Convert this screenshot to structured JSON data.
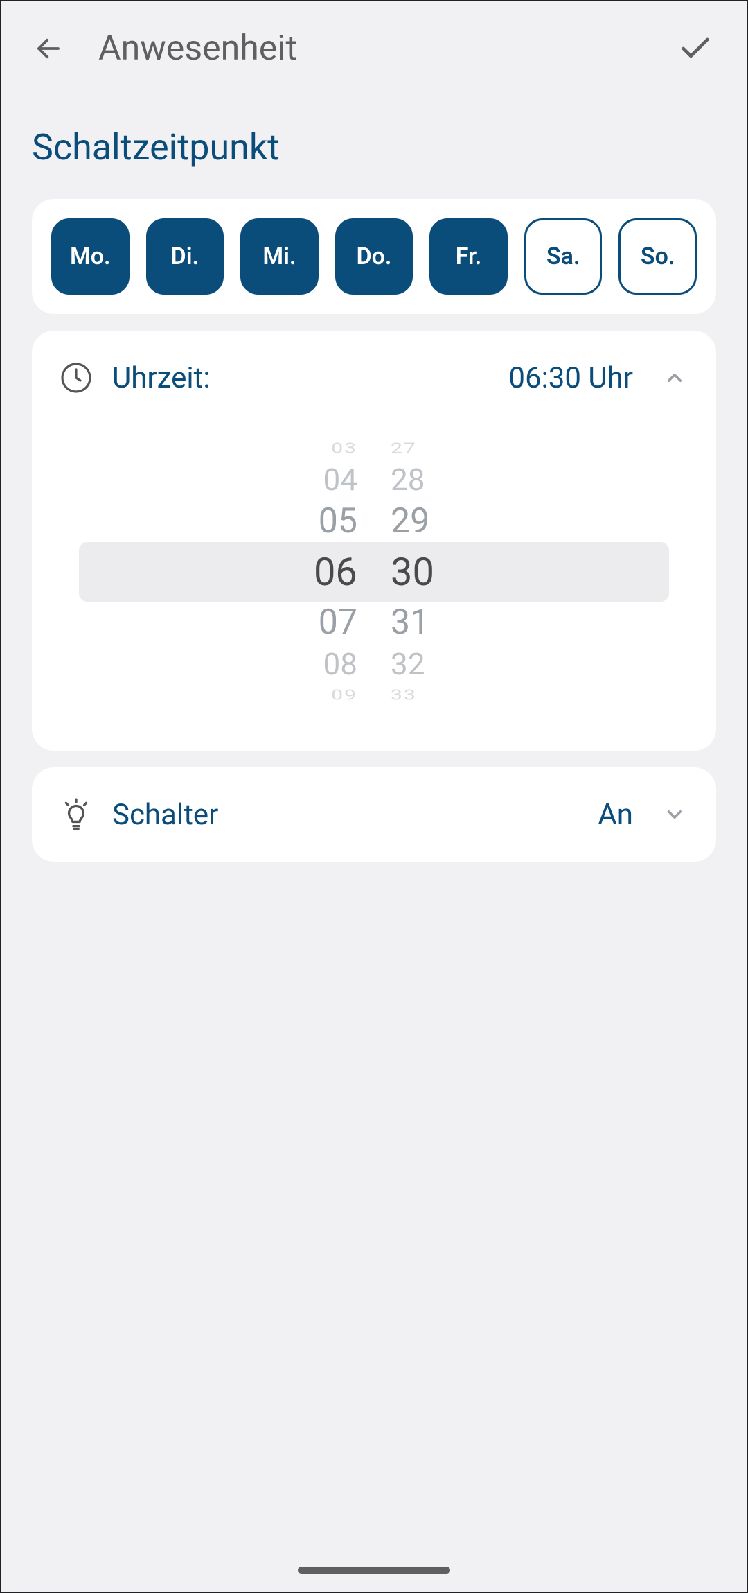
{
  "header": {
    "title": "Anwesenheit"
  },
  "section_title": "Schaltzeitpunkt",
  "days": [
    {
      "label": "Mo.",
      "selected": true
    },
    {
      "label": "Di.",
      "selected": true
    },
    {
      "label": "Mi.",
      "selected": true
    },
    {
      "label": "Do.",
      "selected": true
    },
    {
      "label": "Fr.",
      "selected": true
    },
    {
      "label": "Sa.",
      "selected": false
    },
    {
      "label": "So.",
      "selected": false
    }
  ],
  "time": {
    "label": "Uhrzeit:",
    "value_display": "06:30 Uhr",
    "expanded": true,
    "picker": {
      "hours": [
        "03",
        "04",
        "05",
        "06",
        "07",
        "08",
        "09"
      ],
      "minutes": [
        "27",
        "28",
        "29",
        "30",
        "31",
        "32",
        "33"
      ],
      "selected_hour": "06",
      "selected_minute": "30"
    }
  },
  "switch": {
    "label": "Schalter",
    "value": "An",
    "expanded": false
  }
}
